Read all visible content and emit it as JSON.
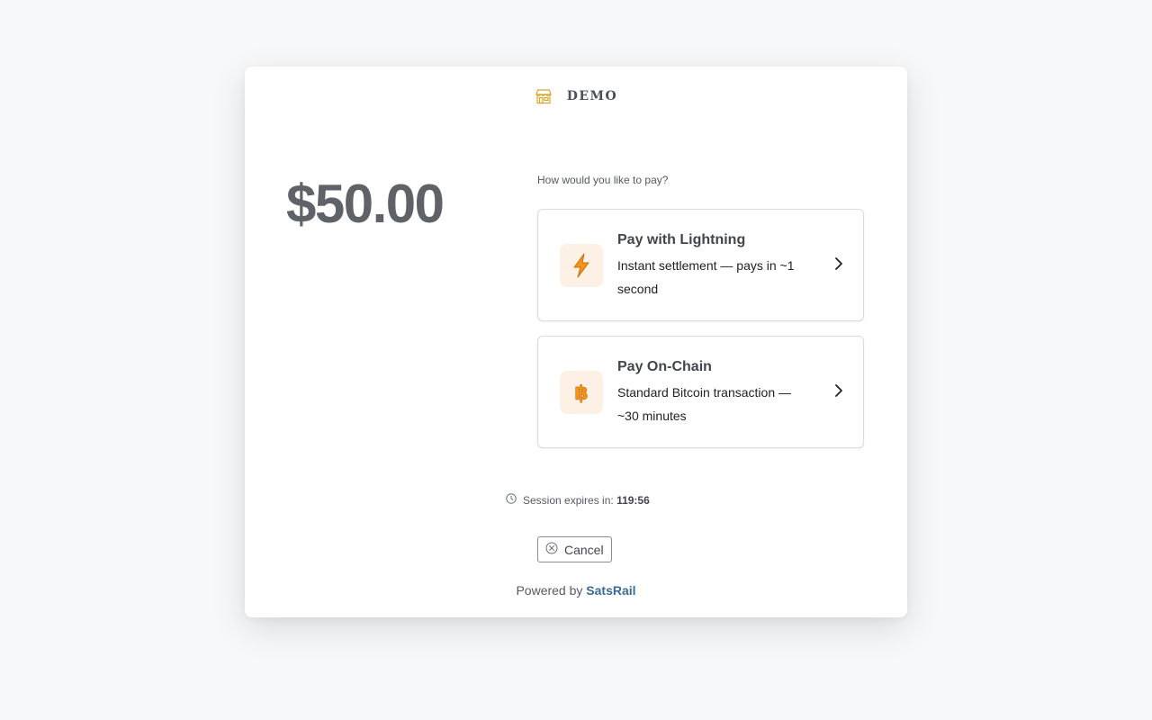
{
  "merchant": {
    "name": "DEMO",
    "icon": "store-icon"
  },
  "payment": {
    "amount": "$50.00",
    "prompt": "How would you like to pay?"
  },
  "options": [
    {
      "icon": "lightning-icon",
      "title": "Pay with Lightning",
      "description": "Instant settlement — pays in ~1 second"
    },
    {
      "icon": "bitcoin-icon",
      "title": "Pay On-Chain",
      "description": "Standard Bitcoin transaction — ~30 minutes"
    }
  ],
  "session": {
    "label": "Session expires in:",
    "time": "119:56"
  },
  "cancel": {
    "label": "Cancel"
  },
  "footer": {
    "prefix": "Powered by",
    "link": "SatsRail"
  },
  "colors": {
    "brand_gold": "#d4a72c",
    "link_blue": "#3b6b93",
    "icon_bg": "#fdf0e4",
    "bitcoin_orange": "#f7931a",
    "amount_gray": "#5f6368"
  }
}
